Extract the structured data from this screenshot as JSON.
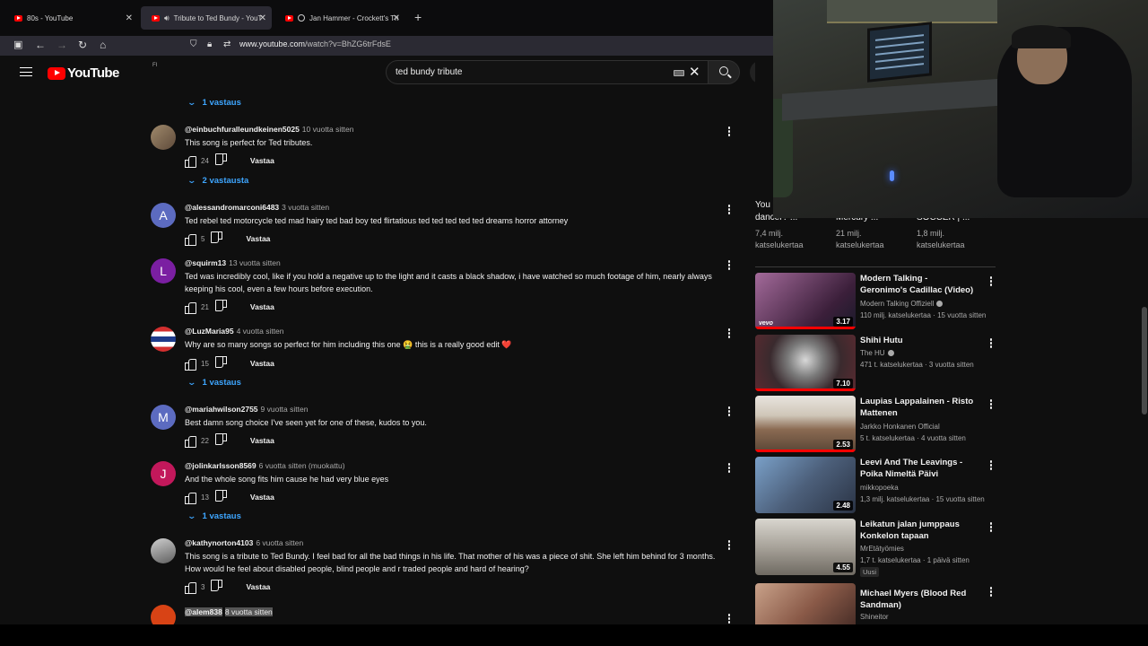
{
  "browser": {
    "tabs": [
      {
        "title": "80s - YouTube",
        "active": false
      },
      {
        "title": "Tribute to Ted Bundy - YouT",
        "active": true
      },
      {
        "title": "Jan Hammer - Crockett's Th",
        "active": false
      }
    ],
    "url_domain": "www.youtube.com",
    "url_path": "/watch?v=BhZG6trFdsE"
  },
  "youtube": {
    "logo_text": "YouTube",
    "country_code": "FI",
    "search_query": "ted bundy tribute"
  },
  "comments": {
    "reply_toggles": [
      "1 vastaus",
      "2 vastausta",
      "1 vastaus",
      "1 vastaus"
    ],
    "reply_label": "Vastaa",
    "items": [
      {
        "user": "@einbuchfuralleundkeinen5025",
        "when": "10 vuotta sitten",
        "text": "This song is perfect for Ted tributes.",
        "likes": "24",
        "avatar_letter": "",
        "avatar_color": "#7a6a58"
      },
      {
        "user": "@alessandromarconi6483",
        "when": "3 vuotta sitten",
        "text": "Ted rebel ted  motorcycle ted mad  hairy ted  bad boy ted  flirtatious ted ted ted ted ted dreams horror attorney",
        "likes": "5",
        "avatar_letter": "A",
        "avatar_color": "#5c6bc0"
      },
      {
        "user": "@squirm13",
        "when": "13 vuotta sitten",
        "text": "Ted was incredibly cool, like if you hold a negative up to the light and it casts a black shadow, i have watched so much footage of him, nearly always keeping his cool, even a few hours before execution.",
        "likes": "21",
        "avatar_letter": "L",
        "avatar_color": "#7b1fa2"
      },
      {
        "user": "@LuzMaria95",
        "when": "4 vuotta sitten",
        "text": "Why are so many songs so perfect for him including this one 🤮 this is a really good edit ❤️",
        "likes": "15",
        "avatar_letter": "",
        "avatar_color": "#1e3a8a"
      },
      {
        "user": "@mariahwilson2755",
        "when": "9 vuotta sitten",
        "text": "Best damn song choice I've seen yet for one of these, kudos to you.",
        "likes": "22",
        "avatar_letter": "M",
        "avatar_color": "#5c6bc0"
      },
      {
        "user": "@jolinkarlsson8569",
        "when": "6 vuotta sitten (muokattu)",
        "text": "And the whole song  fits him cause he had very blue eyes",
        "likes": "13",
        "avatar_letter": "J",
        "avatar_color": "#c2185b"
      },
      {
        "user": "@kathynorton4103",
        "when": "6 vuotta sitten",
        "text": "This song is a tribute to Ted Bundy.  I feel bad for all the bad things in his life.  That mother of his was a piece of shit.  She left him behind for 3 months.  How would he feel about disabled people, blind people and r traded people and hard of hearing?",
        "likes": "3",
        "avatar_letter": "",
        "avatar_color": "#8a8a8a"
      },
      {
        "user": "@alem838",
        "when": "8 vuotta sitten",
        "text": "",
        "likes": "",
        "avatar_letter": "",
        "avatar_color": "#d84315"
      }
    ]
  },
  "shorts_row": [
    {
      "title": "You\ndancer? ...",
      "views": "7,4 milj.",
      "suffix": "katselukertaa"
    },
    {
      "title": "Mercury ...",
      "views": "21 milj.",
      "suffix": "katselukertaa"
    },
    {
      "title": "SOCCER | ...",
      "views": "1,8 milj.",
      "suffix": "katselukertaa"
    }
  ],
  "recommendations": [
    {
      "title": "Modern Talking - Geronimo's Cadillac (Video)",
      "channel": "Modern Talking Offiziell",
      "verified": true,
      "stats": "110 milj. katselukertaa · 15 vuotta sitten",
      "duration": "3.17",
      "badge": "",
      "thumb_color": "#7a4a78",
      "watched": 1.0,
      "vevo": "vevo"
    },
    {
      "title": "Shihi Hutu",
      "channel": "The HU",
      "verified": true,
      "stats": "471 t. katselukertaa · 3 vuotta sitten",
      "duration": "7.10",
      "badge": "",
      "thumb_color": "#6a6a6a",
      "watched": 1.0,
      "vevo": ""
    },
    {
      "title": "Laupias Lappalainen - Risto Mattenen",
      "channel": "Jarkko Honkanen Official",
      "verified": false,
      "stats": "5 t. katselukertaa · 4 vuotta sitten",
      "duration": "2.53",
      "badge": "",
      "thumb_color": "#9a8270",
      "watched": 1.0,
      "vevo": ""
    },
    {
      "title": "Leevi And The Leavings - Poika Nimeltä Päivi",
      "channel": "mikkopoeka",
      "verified": false,
      "stats": "1,3 milj. katselukertaa · 15 vuotta sitten",
      "duration": "2.48",
      "badge": "",
      "thumb_color": "#4c5f7a",
      "watched": 0.0,
      "vevo": ""
    },
    {
      "title": "Leikatun jalan jumppaus Konkelon tapaan",
      "channel": "MrEtätyömies",
      "verified": false,
      "stats": "1,7 t. katselukertaa · 1 päivä sitten",
      "duration": "4.55",
      "badge": "Uusi",
      "thumb_color": "#6f6a62",
      "watched": 0.0,
      "vevo": ""
    },
    {
      "title": "Michael Myers (Blood Red Sandman)",
      "channel": "Shineitor",
      "verified": false,
      "stats": "",
      "duration": "",
      "badge": "",
      "thumb_color": "#8a5a48",
      "watched": 0.0,
      "vevo": ""
    }
  ]
}
